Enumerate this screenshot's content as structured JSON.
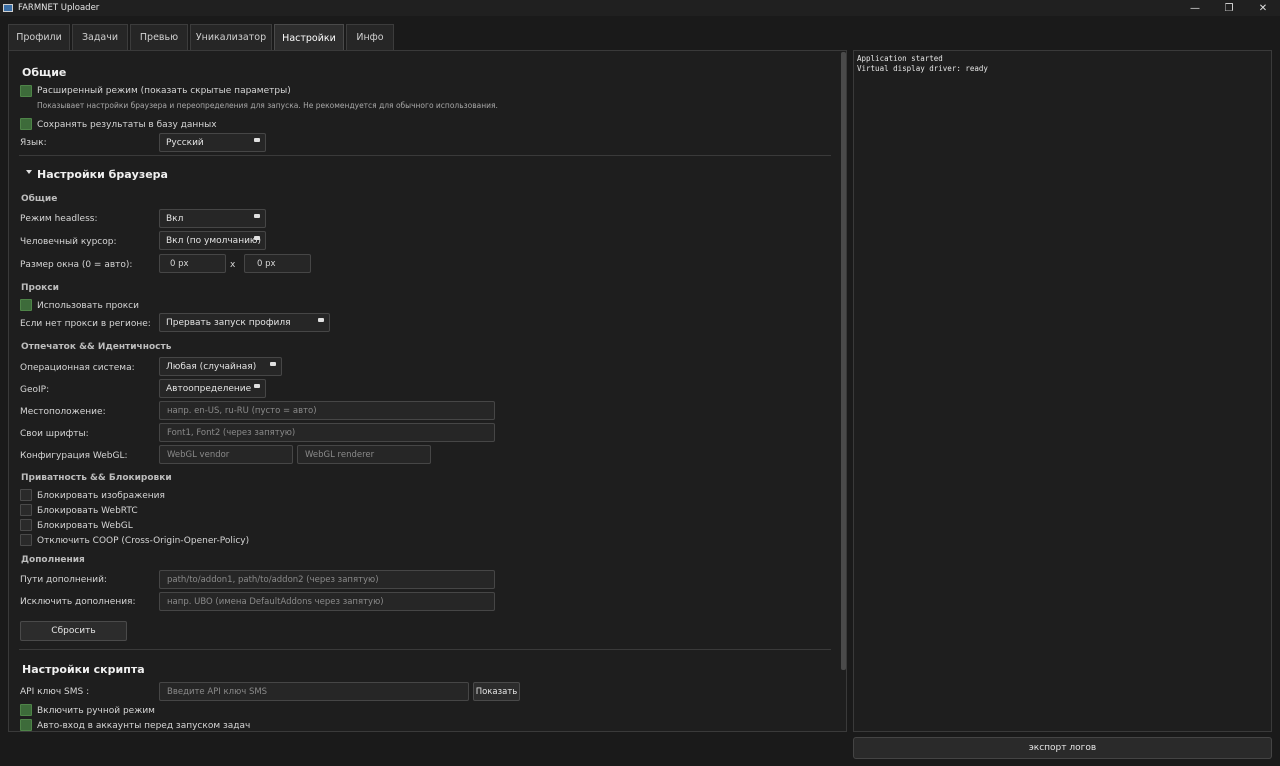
{
  "window": {
    "title": "FARMNET Uploader",
    "minimize": "—",
    "maximize": "❐",
    "close": "✕"
  },
  "tabs": [
    "Профили",
    "Задачи",
    "Превью",
    "Уникализатор",
    "Настройки",
    "Инфо"
  ],
  "active_tab": "Настройки",
  "general": {
    "title": "Общие",
    "advanced_label": "Расширенный режим (показать скрытые параметры)",
    "advanced_checked": true,
    "advanced_hint": "Показывает настройки браузера и переопределения для запуска. Не рекомендуется для обычного использования.",
    "save_db_label": "Сохранять результаты в базу данных",
    "save_db_checked": true,
    "language_label": "Язык:",
    "language_value": "Русский"
  },
  "browser": {
    "title": "Настройки браузера",
    "general_sub": "Общие",
    "headless_label": "Режим headless:",
    "headless_value": "Вкл",
    "cursor_label": "Человечный курсор:",
    "cursor_value": "Вкл (по умолчанию)",
    "window_label": "Размер окна (0 = авто):",
    "window_w": "0 px",
    "window_x": "x",
    "window_h": "0 px",
    "proxy_sub": "Прокси",
    "use_proxy_label": "Использовать прокси",
    "use_proxy_checked": true,
    "no_proxy_label": "Если нет прокси в регионе:",
    "no_proxy_value": "Прервать запуск профиля",
    "fp_sub": "Отпечаток && Идентичность",
    "os_label": "Операционная система:",
    "os_value": "Любая (случайная)",
    "geoip_label": "GeoIP:",
    "geoip_value": "Автоопределение",
    "location_label": "Местоположение:",
    "location_placeholder": "напр. en-US, ru-RU (пусто = авто)",
    "fonts_label": "Свои шрифты:",
    "fonts_placeholder": "Font1, Font2 (через запятую)",
    "webgl_label": "Конфигурация WebGL:",
    "webgl_vendor_placeholder": "WebGL vendor",
    "webgl_renderer_placeholder": "WebGL renderer",
    "privacy_sub": "Приватность && Блокировки",
    "block_images": "Блокировать изображения",
    "block_webrtc": "Блокировать WebRTC",
    "block_webgl": "Блокировать WebGL",
    "disable_coop": "Отключить COOP (Cross-Origin-Opener-Policy)",
    "addons_sub": "Дополнения",
    "addon_paths_label": "Пути дополнений:",
    "addon_paths_placeholder": "path/to/addon1, path/to/addon2 (через запятую)",
    "exclude_addons_label": "Исключить дополнения:",
    "exclude_addons_placeholder": "напр. UBO (имена DefaultAddons через запятую)",
    "reset_button": "Сбросить"
  },
  "script": {
    "title": "Настройки скрипта",
    "api_label": "API ключ SMS :",
    "api_placeholder": "Введите API ключ SMS",
    "show_button": "Показать",
    "manual_mode_label": "Включить ручной режим",
    "manual_mode_checked": true,
    "auto_login_label": "Авто-вход в аккаунты перед запуском задач",
    "auto_login_checked": true
  },
  "log": {
    "lines": [
      "Application started",
      "Virtual display driver: ready"
    ],
    "export_button": "экспорт логов"
  },
  "colors": {
    "checkbox_on": "#3d6b3a",
    "background": "#1a1a1a"
  }
}
